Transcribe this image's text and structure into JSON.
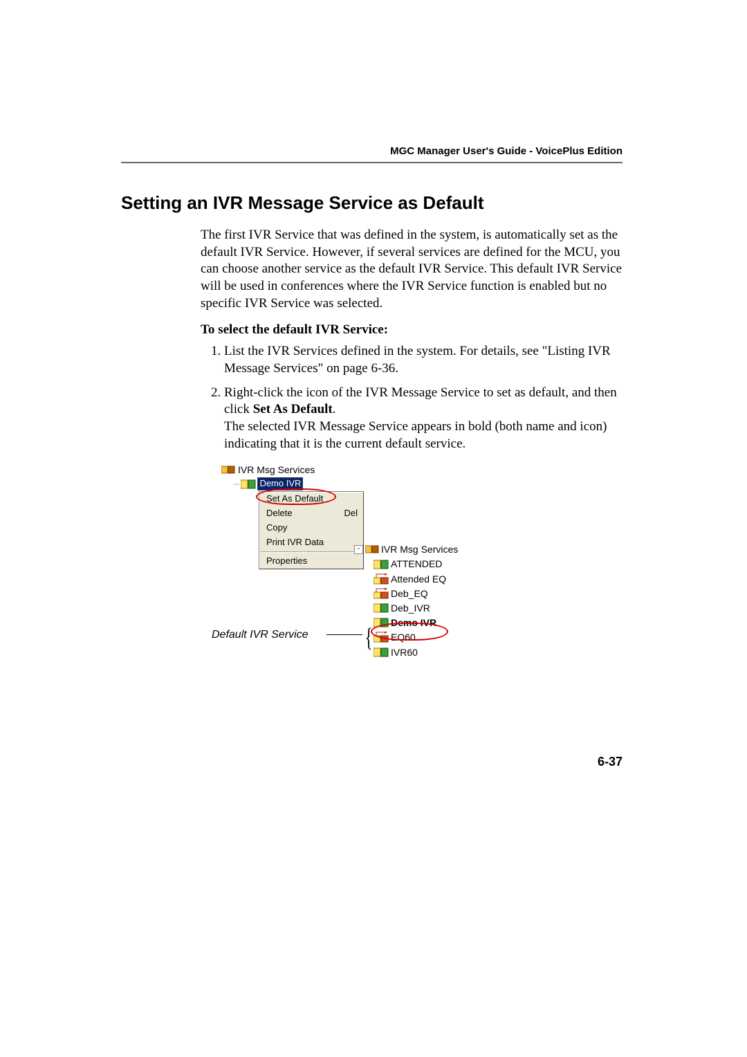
{
  "header": {
    "guide": "MGC Manager User's Guide - VoicePlus Edition"
  },
  "title": "Setting an IVR Message Service as Default",
  "intro": "The first IVR Service that was defined in the system, is automatically set as the default IVR Service. However, if several services are defined for the MCU, you can choose another service as the default IVR Service. This default IVR Service will be used in conferences where the IVR Service function is enabled but no specific IVR Service was selected.",
  "subhead": "To select the default IVR Service:",
  "steps": {
    "s1": "List the IVR Services defined in the system. For details, see \"Listing IVR Message Services\" on page 6-36.",
    "s2a": "Right-click the icon of the IVR Message Service to set as default, and then click ",
    "s2b": "Set As Default",
    "s2c": ".",
    "s2d": "The selected IVR Message Service appears in bold (both name and icon) indicating that it is the current default service."
  },
  "left_tree": {
    "root": "IVR Msg Services",
    "selected": "Demo IVR"
  },
  "menu": {
    "set_default": "Set As Default",
    "delete": "Delete",
    "delete_accel": "Del",
    "copy": "Copy",
    "print": "Print IVR Data",
    "properties": "Properties"
  },
  "right_tree": {
    "root": "IVR Msg Services",
    "n1": "ATTENDED",
    "n2": "Attended EQ",
    "n3": "Deb_EQ",
    "n4": "Deb_IVR",
    "n5": "Demo IVR",
    "n6": "EQ60",
    "n7": "IVR60"
  },
  "callout": "Default IVR Service",
  "page_number": "6-37"
}
